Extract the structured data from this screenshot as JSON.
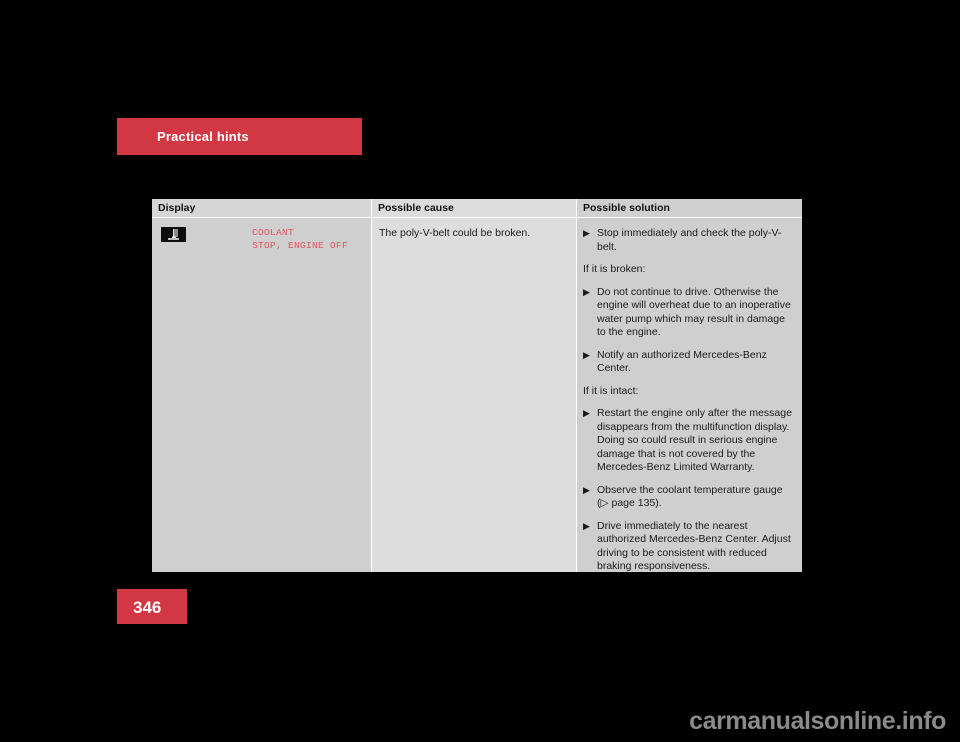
{
  "chapter": {
    "banner_label": "Practical hints"
  },
  "page": {
    "number": "346"
  },
  "table": {
    "headers": {
      "display": "Display",
      "cause": "Possible cause",
      "solution": "Possible solution"
    },
    "row": {
      "display": {
        "icon_name": "coolant-warning-thermometer-icon",
        "message_line1": "COOLANT",
        "message_line2": "STOP, ENGINE OFF",
        "message_color": "#e4545e"
      },
      "cause": "The poly-V-belt could be broken.",
      "solution_blocks": [
        {
          "kind": "bullet",
          "bullet": "▶",
          "text": "Stop immediately and check the poly-V-belt."
        },
        {
          "kind": "lead",
          "text": "If it is broken:"
        },
        {
          "kind": "bullet",
          "bullet": "▶",
          "text": "Do not continue to drive. Otherwise the engine will overheat due to an inoperative water pump which may result in damage to the engine."
        },
        {
          "kind": "bullet",
          "bullet": "▶",
          "text": "Notify an authorized Mercedes-Benz Center."
        },
        {
          "kind": "lead",
          "text": "If it is intact:"
        },
        {
          "kind": "bullet",
          "bullet": "▶",
          "text": "Restart the engine only after the message disappears from the multifunction display. Doing so could result in serious engine damage that is not covered by the Mercedes-Benz Limited Warranty."
        },
        {
          "kind": "bullet",
          "bullet": "▶",
          "text": "Observe the coolant temperature gauge (▷ page 135)."
        },
        {
          "kind": "bullet",
          "bullet": "▶",
          "text": "Drive immediately to the nearest authorized Mercedes-Benz Center. Adjust driving to be consistent with reduced braking responsiveness."
        }
      ]
    }
  },
  "watermark": {
    "text": "carmanualsonline.info"
  },
  "colors": {
    "accent_red": "#d23744",
    "message_red": "#e4545e",
    "page_background": "#000000",
    "table_background": "#d7d7d7"
  }
}
